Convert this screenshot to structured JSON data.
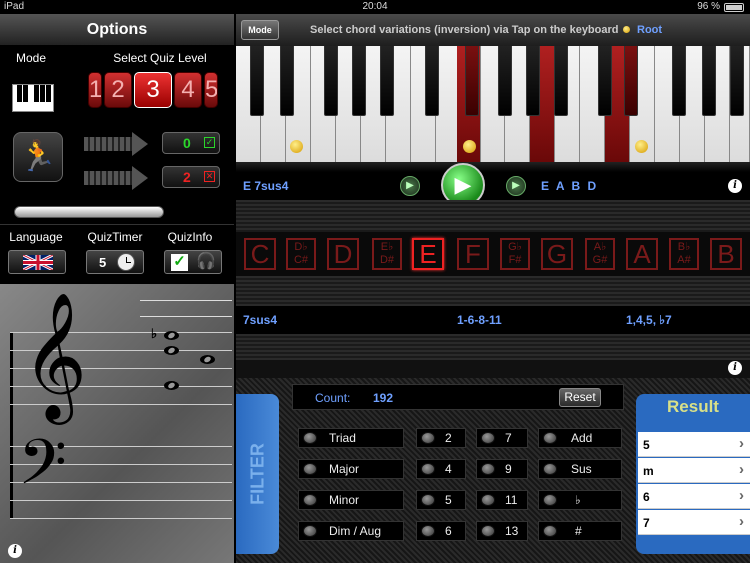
{
  "status": {
    "device": "iPad",
    "time": "20:04",
    "battery": "96 %"
  },
  "options": {
    "title": "Options",
    "mode_label": "Mode",
    "quiz_level_label": "Select Quiz Level",
    "quiz_levels": [
      "1",
      "2",
      "3",
      "4",
      "5"
    ],
    "selected_level": "3",
    "correct_count": "0",
    "wrong_count": "2",
    "progress": 0.7,
    "language_label": "Language",
    "quiz_timer_label": "QuizTimer",
    "quiz_timer_value": "5",
    "quiz_info_label": "QuizInfo"
  },
  "toolbar": {
    "mode_button": "Mode",
    "instruction": "Select chord variations (inversion) via Tap on the keyboard",
    "root_label": "Root"
  },
  "chord": {
    "name": "E 7sus4",
    "notes": "E A B D",
    "type": "7sus4",
    "intervals": "1-6-8-11",
    "formula": "1,4,5, ♭7"
  },
  "note_names": [
    {
      "top": "C",
      "bottom": ""
    },
    {
      "top": "D♭",
      "bottom": "C#"
    },
    {
      "top": "D",
      "bottom": ""
    },
    {
      "top": "E♭",
      "bottom": "D#"
    },
    {
      "top": "E",
      "bottom": ""
    },
    {
      "top": "F",
      "bottom": ""
    },
    {
      "top": "G♭",
      "bottom": "F#"
    },
    {
      "top": "G",
      "bottom": ""
    },
    {
      "top": "A♭",
      "bottom": "G#"
    },
    {
      "top": "A",
      "bottom": ""
    },
    {
      "top": "B♭",
      "bottom": "A#"
    },
    {
      "top": "B",
      "bottom": ""
    }
  ],
  "filter": {
    "tab_label": "FILTER",
    "count_label": "Count:",
    "count_value": "192",
    "reset_label": "Reset",
    "col1": [
      "Triad",
      "Major",
      "Minor",
      "Dim / Aug"
    ],
    "col2": [
      "2",
      "4",
      "5",
      "6"
    ],
    "col3": [
      "7",
      "9",
      "11",
      "13"
    ],
    "col4": [
      "Add",
      "Sus",
      "♭",
      "#"
    ]
  },
  "result": {
    "title": "Result",
    "items": [
      "5",
      "m",
      "6",
      "7"
    ]
  },
  "staff_flat_sign": "♭",
  "colors": {
    "accent_blue": "#2a6ac0",
    "highlight_red": "#e22222",
    "green": "#2bd62b"
  }
}
